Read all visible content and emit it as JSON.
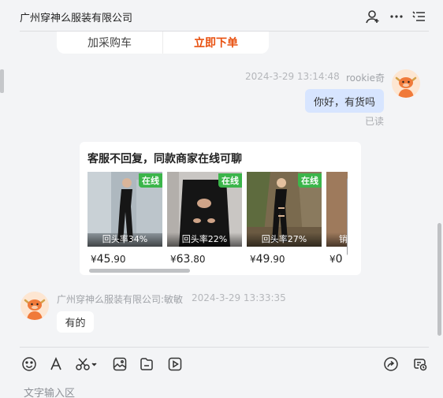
{
  "header": {
    "title": "广州穿神么服装有限公司",
    "icons": [
      "add-user-icon",
      "more-icon",
      "menu-list-icon"
    ]
  },
  "order_card": {
    "add_cart_label": "加采购车",
    "buy_now_label": "立即下单"
  },
  "outgoing_message": {
    "timestamp": "2024-3-29 13:14:48",
    "sender": "rookie奇",
    "text": "你好，有货吗",
    "status": "已读"
  },
  "promo_card": {
    "title": "客服不回复，同款商家在线可聊",
    "products": [
      {
        "badge": "在线",
        "rate": "回头率34%",
        "currency": "¥",
        "price_int": "45",
        "price_dec": ".90"
      },
      {
        "badge": "在线",
        "rate": "回头率22%",
        "currency": "¥",
        "price_int": "63",
        "price_dec": ".80"
      },
      {
        "badge": "在线",
        "rate": "回头率27%",
        "currency": "¥",
        "price_int": "49",
        "price_dec": ".90"
      },
      {
        "badge": "",
        "rate": "销",
        "currency": "¥",
        "price_int": "0",
        "price_dec": ""
      }
    ]
  },
  "incoming_message": {
    "sender": "广州穿神么服装有限公司:敏敏",
    "timestamp": "2024-3-29 13:33:35",
    "text": "有的"
  },
  "toolbar": {
    "icons": [
      "emoji-icon",
      "font-icon",
      "scissors-icon",
      "image-icon",
      "file-icon",
      "video-icon",
      "share-icon",
      "history-icon"
    ]
  },
  "input": {
    "placeholder": "文字输入区"
  },
  "colors": {
    "background": "#f3f4f6",
    "accent_orange": "#e8500f",
    "bubble_out": "#d7e5ff",
    "online_badge": "#3bb54a"
  }
}
